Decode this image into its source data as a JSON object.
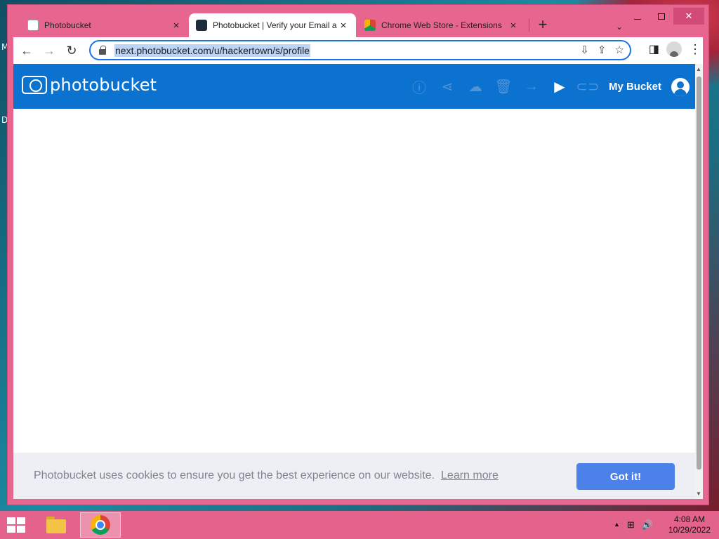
{
  "desktop": {
    "letters": [
      "M",
      "D"
    ]
  },
  "browser": {
    "tabs": [
      {
        "label": "Photobucket",
        "close": "×"
      },
      {
        "label": "Photobucket | Verify your Email a",
        "close": "×"
      },
      {
        "label": "Chrome Web Store - Extensions",
        "close": "×"
      }
    ],
    "new_tab": "+",
    "tab_search": "⌄",
    "window_controls": {
      "close": "✕"
    },
    "nav": {
      "back": "←",
      "forward": "→",
      "reload": "↻"
    },
    "url": "next.photobucket.com/u/hackertown/s/profile",
    "omnibox_icons": {
      "install": "⇩",
      "share": "⇪",
      "bookmark": "☆"
    },
    "toolbar_right": {
      "side_panel": "◨",
      "menu": "⋮"
    }
  },
  "photobucket": {
    "logo_text": "photobucket",
    "actions": {
      "info": "ⓘ",
      "share": "⋖",
      "upload": "☁",
      "delete": "🗑",
      "move": "→",
      "slideshow": "▶",
      "link": "⊂⊃"
    },
    "my_bucket": "My Bucket",
    "colors": {
      "header": "#0c72d0",
      "button": "#4b81e8"
    }
  },
  "cookie_banner": {
    "message": "Photobucket uses cookies to ensure you get the best experience on our website.",
    "learn_more": "Learn more",
    "accept": "Got it!"
  },
  "taskbar": {
    "tray": {
      "up_arrow": "▲",
      "network": "⊞",
      "volume": "🔊"
    },
    "time": "4:08 AM",
    "date": "10/29/2022"
  }
}
